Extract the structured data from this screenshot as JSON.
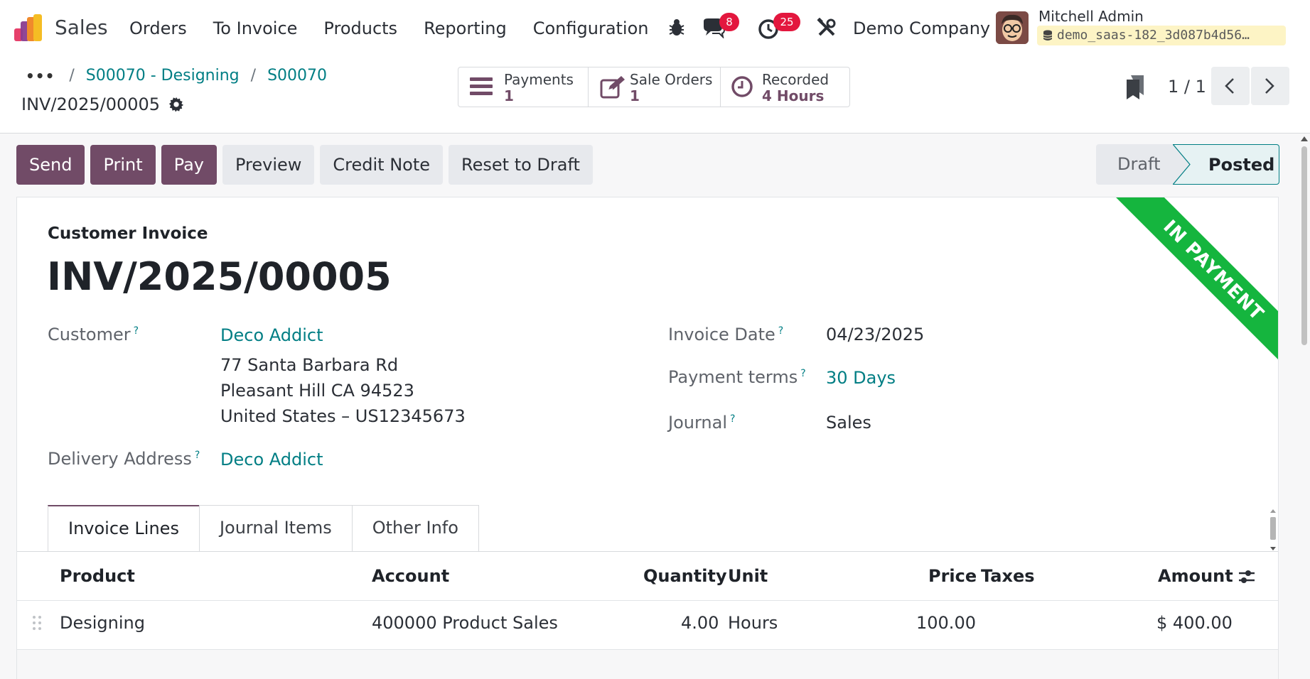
{
  "navbar": {
    "app_name": "Sales",
    "menu": [
      "Orders",
      "To Invoice",
      "Products",
      "Reporting",
      "Configuration"
    ],
    "messages_badge": "8",
    "activities_badge": "25",
    "company": "Demo Company",
    "user_name": "Mitchell Admin",
    "database": "demo_saas-182_3d087b4d56…"
  },
  "breadcrumb": {
    "dots": "•••",
    "items": [
      "S00070 - Designing",
      "S00070"
    ],
    "current": "INV/2025/00005"
  },
  "smart_buttons": [
    {
      "label": "Payments",
      "value": "1",
      "icon": "list-icon"
    },
    {
      "label": "Sale Orders",
      "value": "1",
      "icon": "edit-icon"
    },
    {
      "label": "Recorded",
      "value": "4 Hours",
      "icon": "clock-icon"
    }
  ],
  "pager": {
    "value": "1 / 1"
  },
  "actions": {
    "send": "Send",
    "print": "Print",
    "pay": "Pay",
    "preview": "Preview",
    "credit_note": "Credit Note",
    "reset": "Reset to Draft"
  },
  "status": {
    "draft": "Draft",
    "posted": "Posted",
    "current": "Posted"
  },
  "ribbon": "IN PAYMENT",
  "form": {
    "kind": "Customer Invoice",
    "name": "INV/2025/00005",
    "customer_label": "Customer",
    "customer": "Deco Addict",
    "address": [
      "77 Santa Barbara Rd",
      "Pleasant Hill CA 94523",
      "United States – US12345673"
    ],
    "delivery_label": "Delivery Address",
    "delivery": "Deco Addict",
    "invoice_date_label": "Invoice Date",
    "invoice_date": "04/23/2025",
    "payment_terms_label": "Payment terms",
    "payment_terms": "30 Days",
    "journal_label": "Journal",
    "journal": "Sales",
    "help": "?"
  },
  "tabs": [
    "Invoice Lines",
    "Journal Items",
    "Other Info"
  ],
  "lines": {
    "headers": {
      "product": "Product",
      "account": "Account",
      "quantity": "Quantity",
      "unit": "Unit",
      "price": "Price",
      "taxes": "Taxes",
      "amount": "Amount"
    },
    "rows": [
      {
        "product": "Designing",
        "account": "400000 Product Sales",
        "quantity": "4.00",
        "unit": "Hours",
        "price": "100.00",
        "taxes": "",
        "amount": "$ 400.00"
      }
    ]
  },
  "colors": {
    "brand": "#714b67",
    "link": "#017e84",
    "ribbon": "#15b53e",
    "badge": "#e3173e"
  }
}
